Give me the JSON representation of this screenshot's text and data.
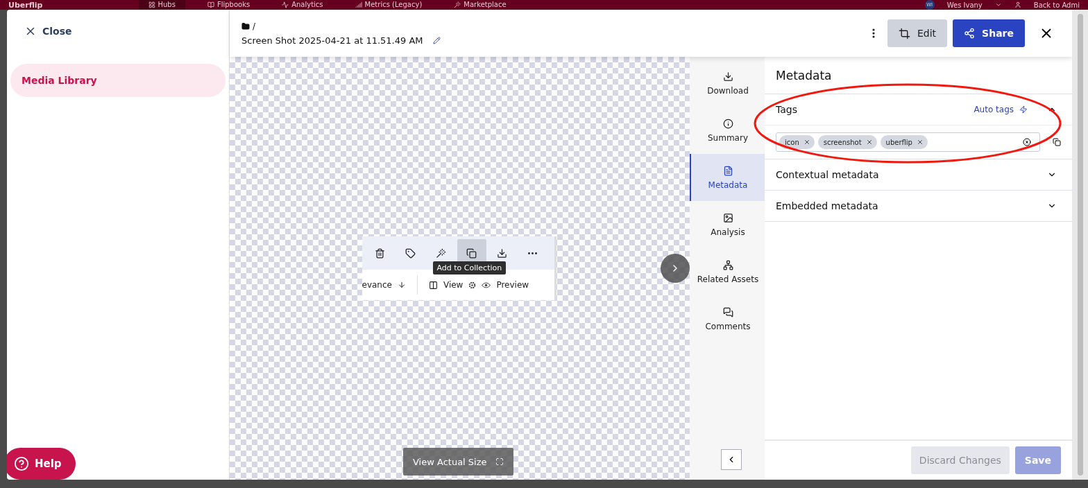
{
  "top_nav": {
    "logo": "Uberflip",
    "items": [
      {
        "label": "Hubs",
        "kind": "grid",
        "selected": true
      },
      {
        "label": "Flipbooks",
        "kind": "book",
        "selected": false
      },
      {
        "label": "Analytics",
        "kind": "chart",
        "selected": false
      },
      {
        "label": "Metrics (Legacy)",
        "kind": "bars",
        "selected": false
      },
      {
        "label": "Marketplace",
        "kind": "wand",
        "selected": false
      }
    ],
    "user": {
      "initials": "WI",
      "name": "Wes Ivany"
    },
    "back_link": "Back to Admi"
  },
  "sidebar": {
    "close": "Close",
    "items": [
      {
        "label": "Media Library",
        "selected": true
      }
    ],
    "help": "Help"
  },
  "header": {
    "breadcrumb": "/",
    "title": "Screen Shot 2025-04-21 at 11.51.49 AM",
    "edit": "Edit",
    "share": "Share"
  },
  "preview": {
    "toolbar": [
      {
        "kind": "delete",
        "active": false
      },
      {
        "kind": "tag",
        "active": false
      },
      {
        "kind": "magic",
        "active": false
      },
      {
        "kind": "collection",
        "active": true
      },
      {
        "kind": "download",
        "active": false
      },
      {
        "kind": "more",
        "active": false
      }
    ],
    "sort_label": "evance",
    "view_label": "View",
    "preview_label": "Preview",
    "tooltip": "Add to Collection",
    "actual_size": "View Actual Size"
  },
  "rail": [
    {
      "label": "Download",
      "kind": "download",
      "selected": false
    },
    {
      "label": "Summary",
      "kind": "info",
      "selected": false
    },
    {
      "label": "Metadata",
      "kind": "doc",
      "selected": true
    },
    {
      "label": "Analysis",
      "kind": "image",
      "selected": false
    },
    {
      "label": "Related Assets",
      "kind": "network",
      "selected": false
    },
    {
      "label": "Comments",
      "kind": "comments",
      "selected": false
    }
  ],
  "metadata": {
    "title": "Metadata",
    "sections": [
      {
        "title": "Tags",
        "expanded": true,
        "auto_tags": "Auto tags",
        "tags": [
          "icon",
          "screenshot",
          "uberflip"
        ]
      },
      {
        "title": "Contextual metadata",
        "expanded": false
      },
      {
        "title": "Embedded metadata",
        "expanded": false
      }
    ],
    "discard": {
      "label": "Discard Changes",
      "disabled": true
    },
    "save": {
      "label": "Save",
      "disabled": true
    }
  }
}
